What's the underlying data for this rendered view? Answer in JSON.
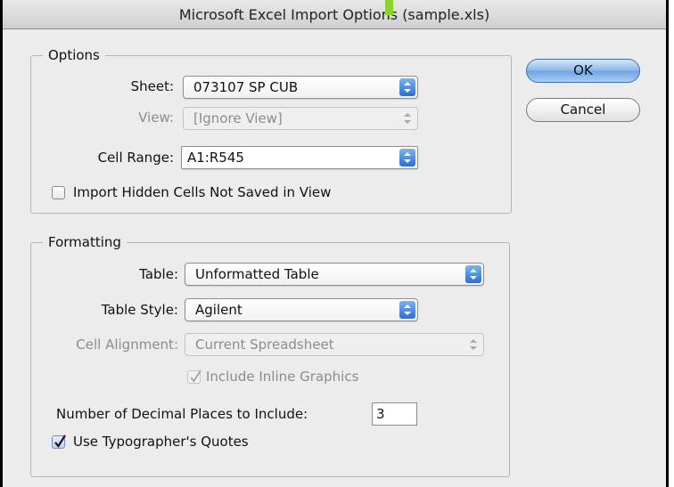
{
  "window": {
    "title": "Microsoft Excel Import Options (sample.xls)"
  },
  "options": {
    "legend": "Options",
    "sheet": {
      "label": "Sheet:",
      "value": "073107 SP CUB"
    },
    "view": {
      "label": "View:",
      "value": "[Ignore View]"
    },
    "cell_range": {
      "label": "Cell Range:",
      "value": "A1:R545"
    },
    "import_hidden": {
      "label": "Import Hidden Cells Not Saved in View",
      "checked": false
    }
  },
  "formatting": {
    "legend": "Formatting",
    "table": {
      "label": "Table:",
      "value": "Unformatted Table"
    },
    "table_style": {
      "label": "Table Style:",
      "value": "Agilent"
    },
    "cell_alignment": {
      "label": "Cell Alignment:",
      "value": "Current Spreadsheet"
    },
    "include_inline_graphics": {
      "label": "Include Inline Graphics",
      "checked": true,
      "enabled": false
    },
    "decimal_places": {
      "label": "Number of Decimal Places to Include:",
      "value": "3"
    },
    "typographers_quotes": {
      "label": "Use Typographer's Quotes",
      "checked": true
    }
  },
  "buttons": {
    "ok": "OK",
    "cancel": "Cancel"
  },
  "colors": {
    "accent": "#2a6ed6",
    "dialog_bg": "#ececec",
    "disabled_text": "#8c8c8c"
  },
  "icons": {
    "popup_arrows": "up-down-arrows-icon",
    "check": "checkmark-icon"
  }
}
